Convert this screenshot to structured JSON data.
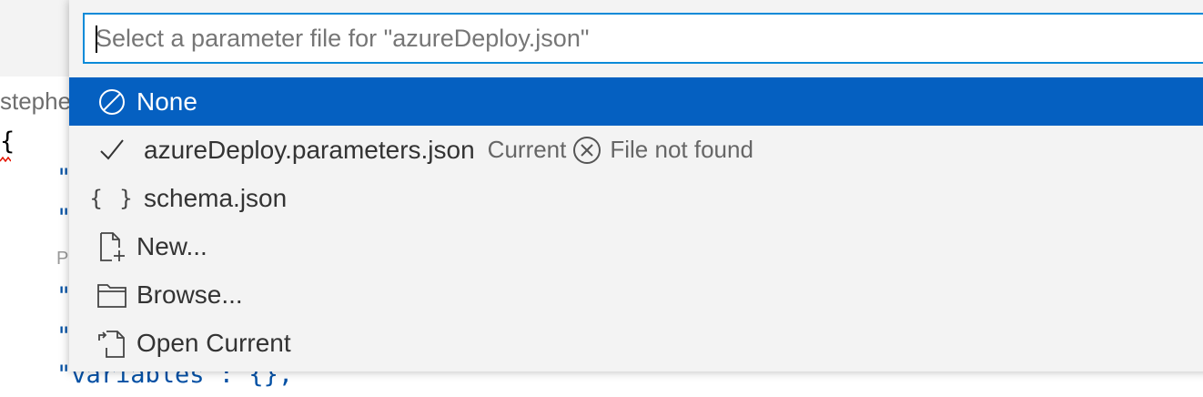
{
  "quick_pick": {
    "placeholder": "Select a parameter file for \"azureDeploy.json\"",
    "value": "",
    "items": [
      {
        "icon": "none-icon",
        "label": "None",
        "selected": true
      },
      {
        "icon": "check-icon",
        "label": "azureDeploy.parameters.json",
        "description": "Current",
        "detail_icon": "error-circle-icon",
        "detail": "File not found"
      },
      {
        "icon": "braces-icon",
        "icon_text": "{ }",
        "label": "schema.json"
      },
      {
        "icon": "new-file-icon",
        "label": "New..."
      },
      {
        "icon": "folder-icon",
        "label": "Browse..."
      },
      {
        "icon": "open-file-icon",
        "label": "Open Current"
      }
    ]
  },
  "editor": {
    "breadcrumb": "stephe",
    "lines": [
      "{",
      "\"",
      "\"",
      "P",
      "\"",
      "\"",
      "\"variables\": {},"
    ]
  },
  "colors": {
    "selection": "#0560c1",
    "focus_border": "#0a8ad8",
    "widget_bg": "#f3f3f3",
    "json_key": "#0451a5"
  }
}
